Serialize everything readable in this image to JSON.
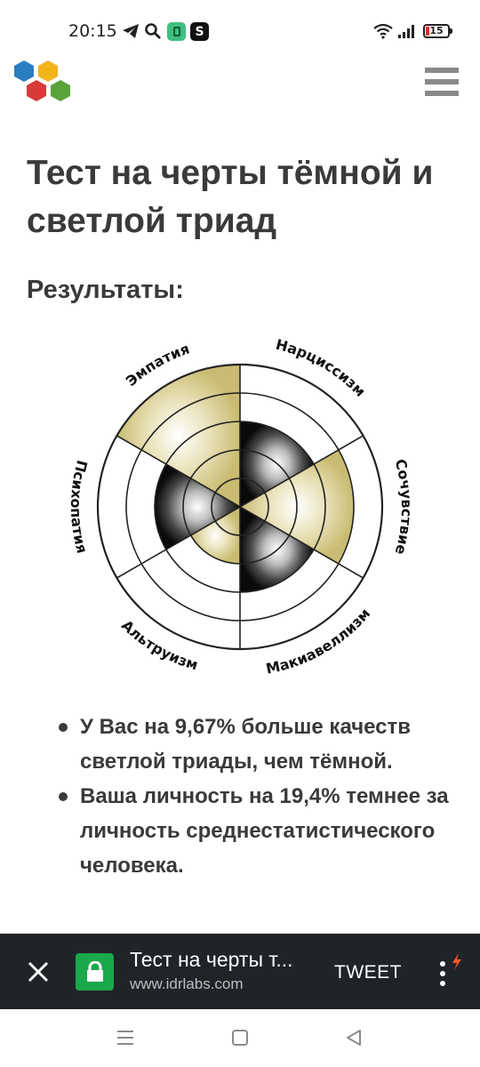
{
  "status_bar": {
    "time": "20:15",
    "icons": [
      "telegram-icon",
      "search-icon",
      "app-icon",
      "s-app-icon",
      "wifi-icon",
      "signal-icon"
    ],
    "app2_label": "S",
    "battery_level": "15",
    "battery_color": "#e0292c"
  },
  "header": {
    "logo": "idrlabs-hexagon-logo",
    "logo_colors": [
      "#2a7fc1",
      "#f1b51c",
      "#d83a3a",
      "#5aa33b"
    ],
    "menu_icon": "hamburger-icon"
  },
  "main": {
    "title": "Тест на черты тёмной и светлой триад",
    "results_heading": "Результаты:",
    "results": [
      "У Вас на 9,67% больше качеств светлой триады, чем тёмной.",
      "Ваша личность на 19,4% темнее за личность среднестатистического человека."
    ]
  },
  "chart_data": {
    "type": "radial-bar",
    "rings": 5,
    "sectors": [
      {
        "label": "Нарциссизм",
        "value": 3,
        "triad": "dark"
      },
      {
        "label": "Сочувствие",
        "value": 4,
        "triad": "light"
      },
      {
        "label": "Макиавеллизм",
        "value": 3,
        "triad": "dark"
      },
      {
        "label": "Альтруизм",
        "value": 2,
        "triad": "light"
      },
      {
        "label": "Психопатия",
        "value": 3,
        "triad": "dark"
      },
      {
        "label": "Эмпатия",
        "value": 5,
        "triad": "light"
      }
    ],
    "colors": {
      "dark": "#111111",
      "light": "#c9bc72",
      "outline": "#222222"
    }
  },
  "tab_bar": {
    "title": "Тест на черты т...",
    "url": "www.idrlabs.com",
    "tweet_label": "TWEET",
    "lock_color": "#1aa84a",
    "background": "#1f2428"
  },
  "nav_bar": {
    "icons": [
      "recent-apps-icon",
      "home-icon",
      "back-icon"
    ]
  }
}
